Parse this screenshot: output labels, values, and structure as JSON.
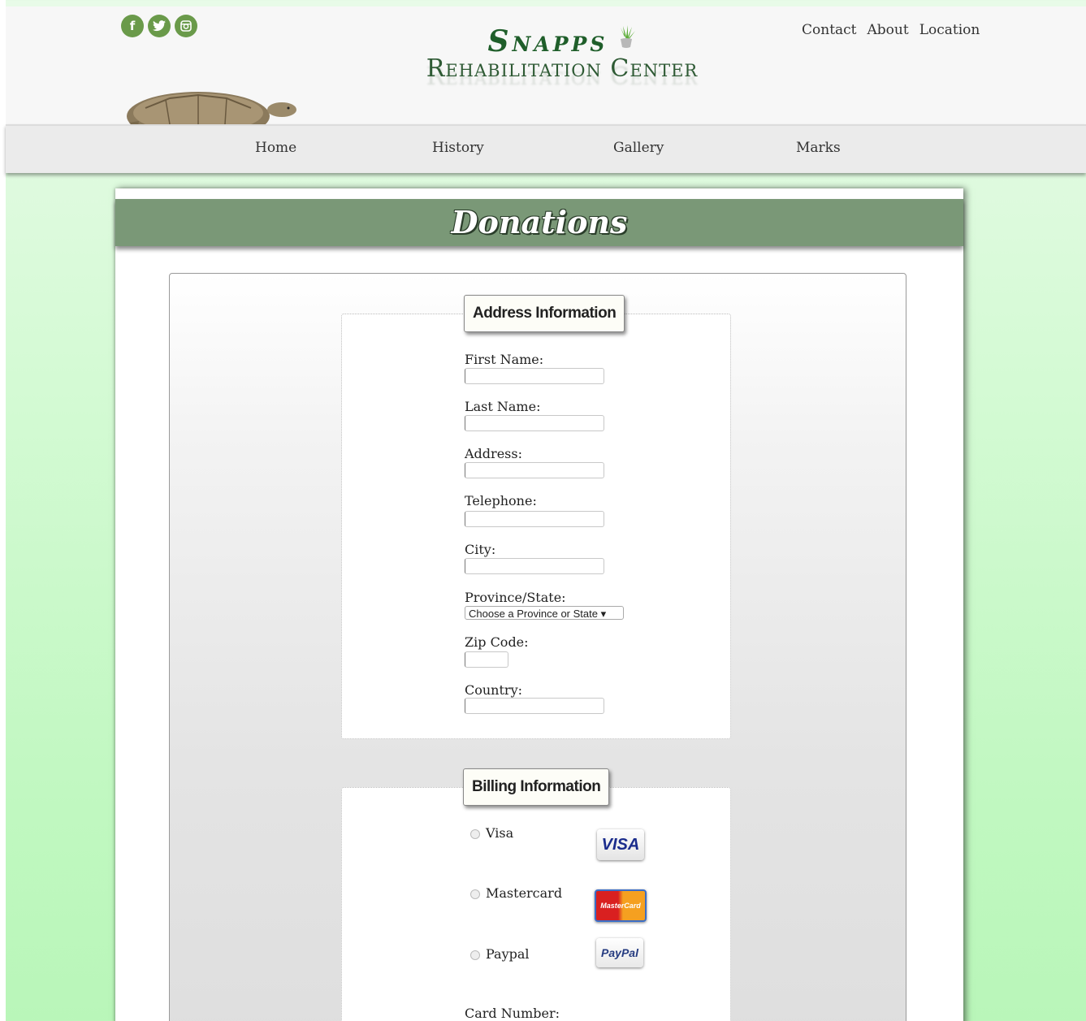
{
  "header": {
    "social": [
      {
        "icon": "facebook-icon",
        "glyph": "f"
      },
      {
        "icon": "twitter-icon",
        "glyph": "t"
      },
      {
        "icon": "instagram-icon",
        "glyph": "◘"
      }
    ],
    "logo_line1": "Snapps",
    "logo_line2": "Rehabilitation Center",
    "top_links": [
      "Contact",
      "About",
      "Location"
    ]
  },
  "nav": {
    "items": [
      "Home",
      "History",
      "Gallery",
      "Marks"
    ]
  },
  "page": {
    "title": "Donations"
  },
  "address": {
    "legend": "Address Information",
    "fields": [
      {
        "label": "First Name:",
        "value": ""
      },
      {
        "label": "Last Name:",
        "value": ""
      },
      {
        "label": "Address:",
        "value": ""
      },
      {
        "label": "Telephone:",
        "value": ""
      },
      {
        "label": "City:",
        "value": ""
      },
      {
        "label": "Province/State:",
        "selected": "Choose a Province or State ▾"
      },
      {
        "label": "Zip Code:",
        "value": ""
      },
      {
        "label": "Country:",
        "value": ""
      }
    ]
  },
  "billing": {
    "legend": "Billing Information",
    "options": [
      {
        "label": "Visa",
        "card_text": "VISA",
        "icon": "visa-card-icon"
      },
      {
        "label": "Mastercard",
        "card_text": "MasterCard",
        "icon": "mastercard-icon"
      },
      {
        "label": "Paypal",
        "card_text": "PayPal",
        "icon": "paypal-icon"
      }
    ],
    "card_number_label": "Card Number:"
  },
  "colors": {
    "accent_green": "#7a9877",
    "logo_green": "#1f5e2a",
    "background_green": "#c0f8c0"
  }
}
